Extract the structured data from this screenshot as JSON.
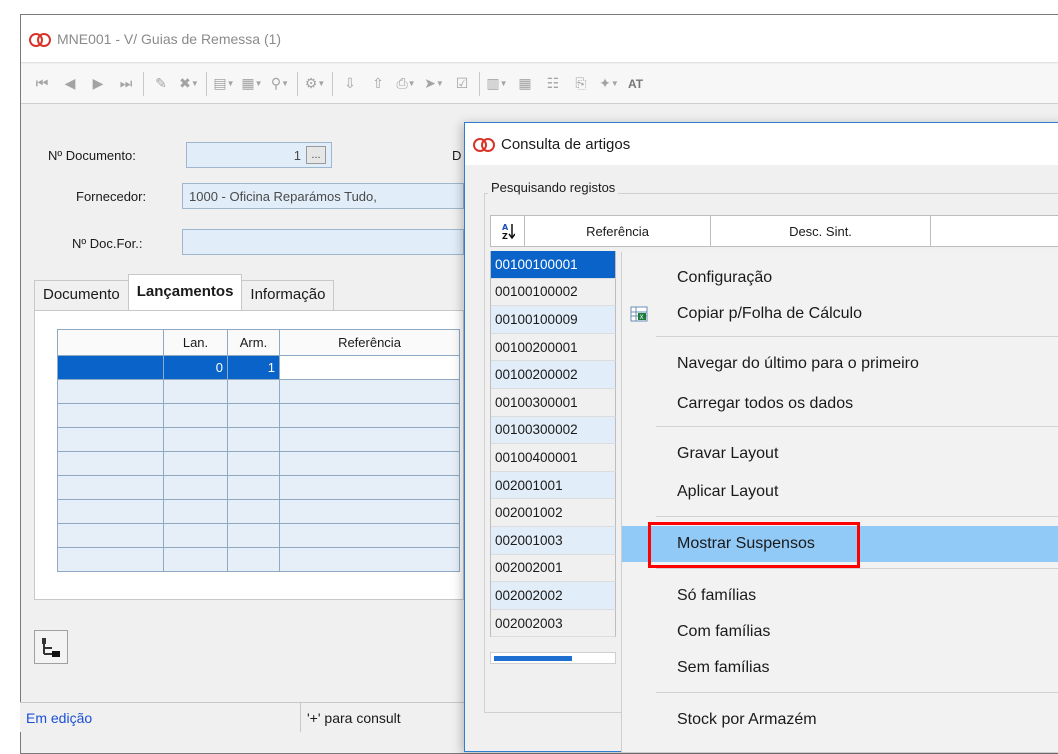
{
  "main_window": {
    "title": "MNE001 - V/ Guias de Remessa (1)",
    "toolbar": {
      "trailing_label": "AT"
    },
    "fields": {
      "doc_number_label": "Nº Documento:",
      "doc_number_value": "1",
      "doc_number_ellipsis": "...",
      "extra_label": "D",
      "supplier_label": "Fornecedor:",
      "supplier_value": "1000 - Oficina Reparámos Tudo,",
      "supplier_doc_label": "Nº Doc.For.:",
      "supplier_doc_value": ""
    },
    "tabs": [
      {
        "label": "Documento",
        "active": false
      },
      {
        "label": "Lançamentos",
        "active": true
      },
      {
        "label": "Informação",
        "active": false
      }
    ],
    "grid": {
      "columns": [
        "",
        "Lan.",
        "Arm.",
        "Referência"
      ],
      "rows": [
        {
          "lan": "0",
          "arm": "1",
          "ref": ""
        }
      ]
    },
    "status": {
      "left": "Em edição",
      "right": "'+' para consult"
    }
  },
  "dialog": {
    "title": "Consulta de artigos",
    "group_label": "Pesquisando registos",
    "columns": [
      "Referência",
      "Desc. Sint."
    ],
    "sort_icon": "sort-az-icon",
    "references": [
      "00100100001",
      "00100100002",
      "00100100009",
      "00100200001",
      "00100200002",
      "00100300001",
      "00100300002",
      "00100400001",
      "002001001",
      "002001002",
      "002001003",
      "002002001",
      "002002002",
      "002002003"
    ]
  },
  "context_menu": {
    "items": [
      "Configuração",
      "Copiar p/Folha de Cálculo",
      "Navegar do último para o primeiro",
      "Carregar todos os dados",
      "Gravar Layout",
      "Aplicar Layout",
      "Mostrar Suspensos",
      "Só famílias",
      "Com famílias",
      "Sem famílias",
      "Stock por Armazém"
    ],
    "highlighted": "Mostrar Suspensos",
    "highlight_color": "#91c9f7",
    "callout_color": "#ff0000"
  },
  "colors": {
    "selection": "#0a63c9",
    "field_bg": "#e1edf8",
    "status_text": "#1c4fd6",
    "logo": "#d8352a"
  }
}
